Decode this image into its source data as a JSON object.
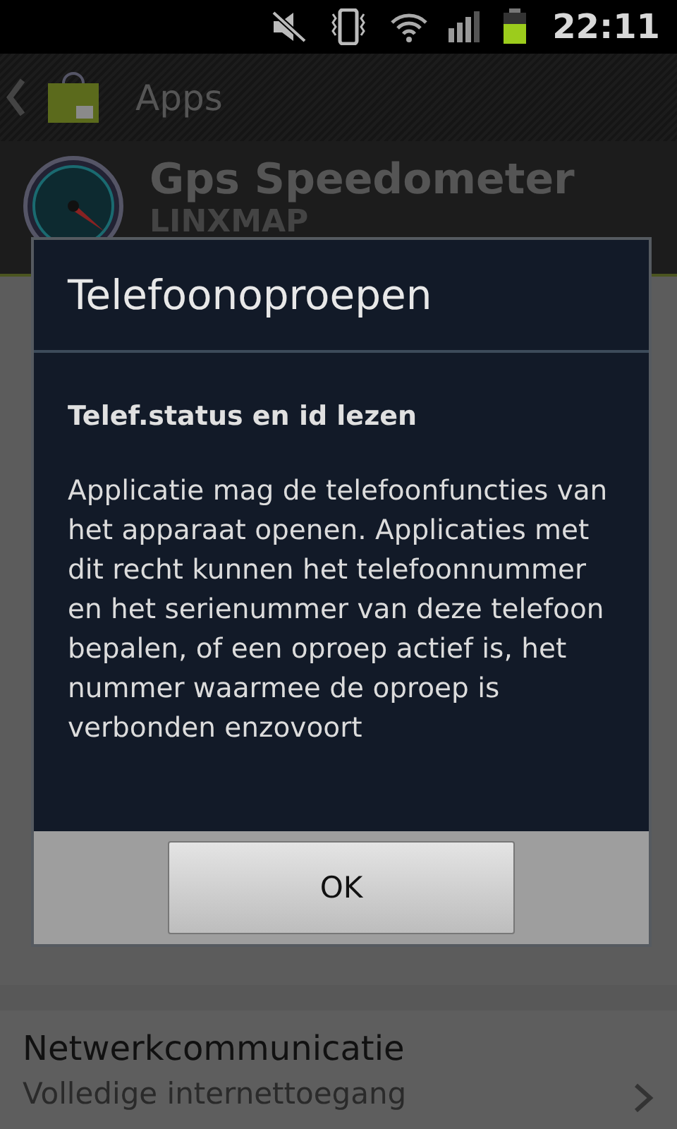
{
  "status_bar": {
    "time": "22:11"
  },
  "action_bar": {
    "title": "Apps"
  },
  "app": {
    "name": "Gps Speedometer",
    "developer": "LINXMAP"
  },
  "permissions": [
    {
      "title": "Netwerkcommunicatie",
      "description": "Volledige internettoegang"
    }
  ],
  "dialog": {
    "title": "Telefoonoproepen",
    "permission": "Telef.status en id lezen",
    "description": "Applicatie mag de telefoonfuncties van het apparaat openen. Applicaties met dit recht kunnen het telefoonnummer en het serienummer van deze telefoon bepalen, of een oproep actief is, het nummer waarmee de oproep is verbonden enzovoort",
    "buttons": [
      "OK"
    ]
  }
}
